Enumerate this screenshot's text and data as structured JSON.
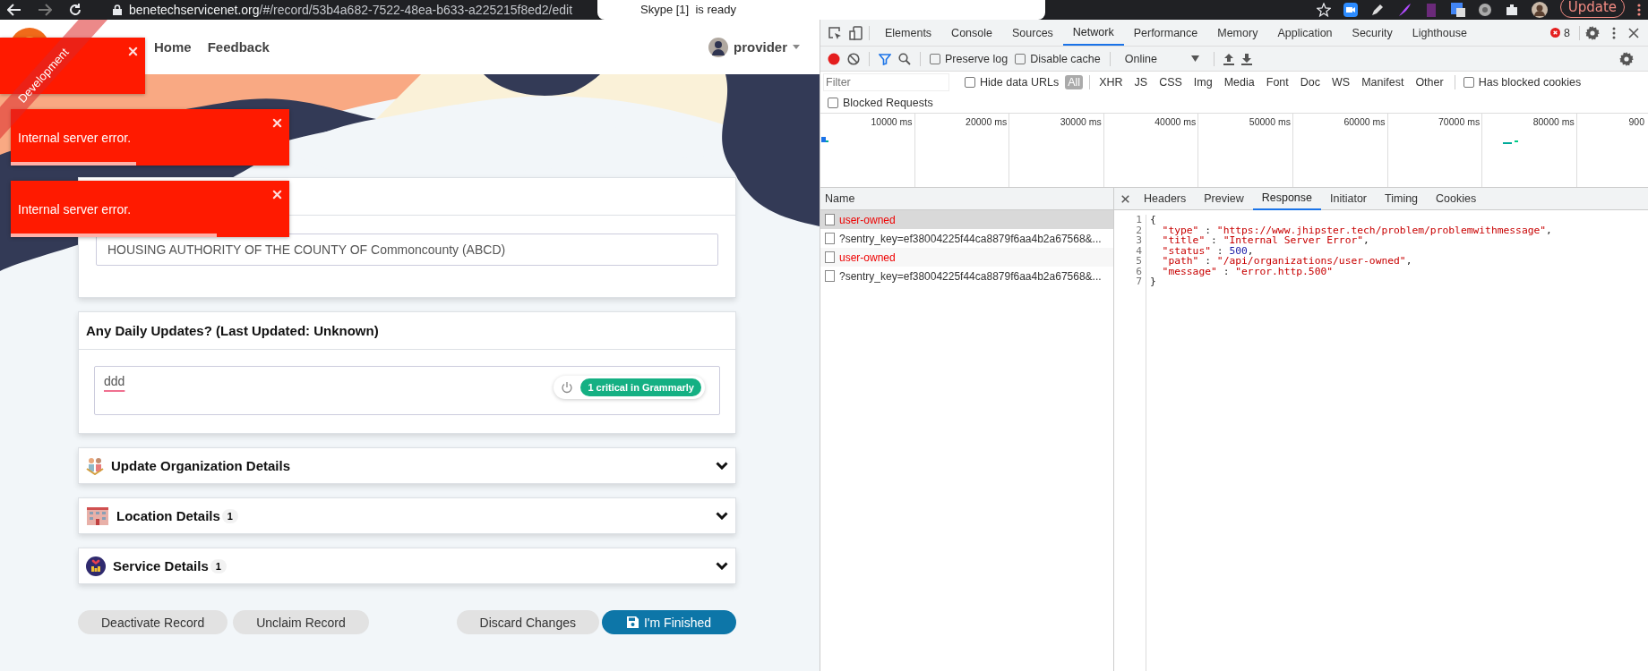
{
  "browser": {
    "url_host": "benetechservicenet.org",
    "url_path": "/#/record/53b4a682-7522-48ea-b633-a225215f8ed2/edit",
    "notification": "Skype [1]  is ready",
    "update_button": "Update"
  },
  "app": {
    "ribbon": "Development",
    "nav": [
      "Home",
      "Feedback"
    ],
    "user": "provider",
    "toasts": [
      {
        "kind": "partial"
      },
      {
        "kind": "message",
        "message": "Internal server error.",
        "level": 0.45
      },
      {
        "kind": "message",
        "message": "Internal server error.",
        "level": 0.74
      }
    ],
    "name_field": {
      "value": "HOUSING AUTHORITY OF THE COUNTY OF Commoncounty (ABCD)"
    },
    "updates": {
      "title": "Any Daily Updates? (Last Updated: Unknown)",
      "value": "ddd",
      "grammarly": "1 critical in Grammarly"
    },
    "sections": [
      {
        "title": "Update Organization Details",
        "expanded": false
      },
      {
        "title": "Location Details",
        "count": "1",
        "expanded": false
      },
      {
        "title": "Service Details",
        "count": "1",
        "expanded": false
      }
    ],
    "actions": [
      {
        "label": "Deactivate Record",
        "kind": "secondary"
      },
      {
        "label": "Unclaim Record",
        "kind": "secondary"
      },
      {
        "label": "Discard Changes",
        "kind": "secondary"
      },
      {
        "label": "I'm Finished",
        "kind": "primary"
      }
    ]
  },
  "devtools": {
    "tabs": [
      {
        "label": "Elements",
        "selected": false
      },
      {
        "label": "Console",
        "selected": false
      },
      {
        "label": "Sources",
        "selected": false
      },
      {
        "label": "Network",
        "selected": true
      },
      {
        "label": "Performance",
        "selected": false
      },
      {
        "label": "Memory",
        "selected": false
      },
      {
        "label": "Application",
        "selected": false
      },
      {
        "label": "Security",
        "selected": false
      },
      {
        "label": "Lighthouse",
        "selected": false
      }
    ],
    "error_count": "8",
    "preserve_log": {
      "label": "Preserve log",
      "checked": false
    },
    "disable_cache": {
      "label": "Disable cache",
      "checked": false
    },
    "throttling": "Online",
    "filter": {
      "placeholder": "Filter"
    },
    "hide_data_urls": {
      "label": "Hide data URLs",
      "checked": false
    },
    "type_filters": [
      {
        "label": "All",
        "selected": true
      },
      {
        "label": "XHR",
        "selected": false
      },
      {
        "label": "JS",
        "selected": false
      },
      {
        "label": "CSS",
        "selected": false
      },
      {
        "label": "Img",
        "selected": false
      },
      {
        "label": "Media",
        "selected": false
      },
      {
        "label": "Font",
        "selected": false
      },
      {
        "label": "Doc",
        "selected": false
      },
      {
        "label": "WS",
        "selected": false
      },
      {
        "label": "Manifest",
        "selected": false
      },
      {
        "label": "Other",
        "selected": false
      }
    ],
    "blocked_cookies": {
      "label": "Has blocked cookies",
      "checked": false
    },
    "blocked_requests": {
      "label": "Blocked Requests",
      "checked": false
    },
    "timeline_ticks": [
      "10000 ms",
      "20000 ms",
      "30000 ms",
      "40000 ms",
      "50000 ms",
      "60000 ms",
      "70000 ms",
      "80000 ms",
      "900"
    ],
    "name_header": "Name",
    "requests": [
      {
        "name": "user-owned",
        "failed": true,
        "selected": true
      },
      {
        "name": "?sentry_key=ef38004225f44ca8879f6aa4b2a67568&...",
        "failed": false,
        "selected": false
      },
      {
        "name": "user-owned",
        "failed": true,
        "selected": false
      },
      {
        "name": "?sentry_key=ef38004225f44ca8879f6aa4b2a67568&...",
        "failed": false,
        "selected": false
      }
    ],
    "detail_tabs": [
      {
        "label": "Headers",
        "selected": false
      },
      {
        "label": "Preview",
        "selected": false
      },
      {
        "label": "Response",
        "selected": true
      },
      {
        "label": "Initiator",
        "selected": false
      },
      {
        "label": "Timing",
        "selected": false
      },
      {
        "label": "Cookies",
        "selected": false
      }
    ],
    "response_lines": [
      {
        "number": "1",
        "tokens": [
          {
            "kind": "punct",
            "text": "{"
          }
        ]
      },
      {
        "number": "2",
        "tokens": [
          {
            "kind": "string",
            "text": "  \"type\""
          },
          {
            "kind": "punct",
            "text": " : "
          },
          {
            "kind": "string",
            "text": "\"https://www.jhipster.tech/problem/problemwithmessage\""
          },
          {
            "kind": "punct",
            "text": ","
          }
        ]
      },
      {
        "number": "3",
        "tokens": [
          {
            "kind": "string",
            "text": "  \"title\""
          },
          {
            "kind": "punct",
            "text": " : "
          },
          {
            "kind": "string",
            "text": "\"Internal Server Error\""
          },
          {
            "kind": "punct",
            "text": ","
          }
        ]
      },
      {
        "number": "4",
        "tokens": [
          {
            "kind": "string",
            "text": "  \"status\""
          },
          {
            "kind": "punct",
            "text": " : "
          },
          {
            "kind": "number",
            "text": "500"
          },
          {
            "kind": "punct",
            "text": ","
          }
        ]
      },
      {
        "number": "5",
        "tokens": [
          {
            "kind": "string",
            "text": "  \"path\""
          },
          {
            "kind": "punct",
            "text": " : "
          },
          {
            "kind": "string",
            "text": "\"/api/organizations/user-owned\""
          },
          {
            "kind": "punct",
            "text": ","
          }
        ]
      },
      {
        "number": "6",
        "tokens": [
          {
            "kind": "string",
            "text": "  \"message\""
          },
          {
            "kind": "punct",
            "text": " : "
          },
          {
            "kind": "string",
            "text": "\"error.http.500\""
          }
        ]
      },
      {
        "number": "7",
        "tokens": [
          {
            "kind": "punct",
            "text": "}"
          }
        ]
      }
    ]
  }
}
